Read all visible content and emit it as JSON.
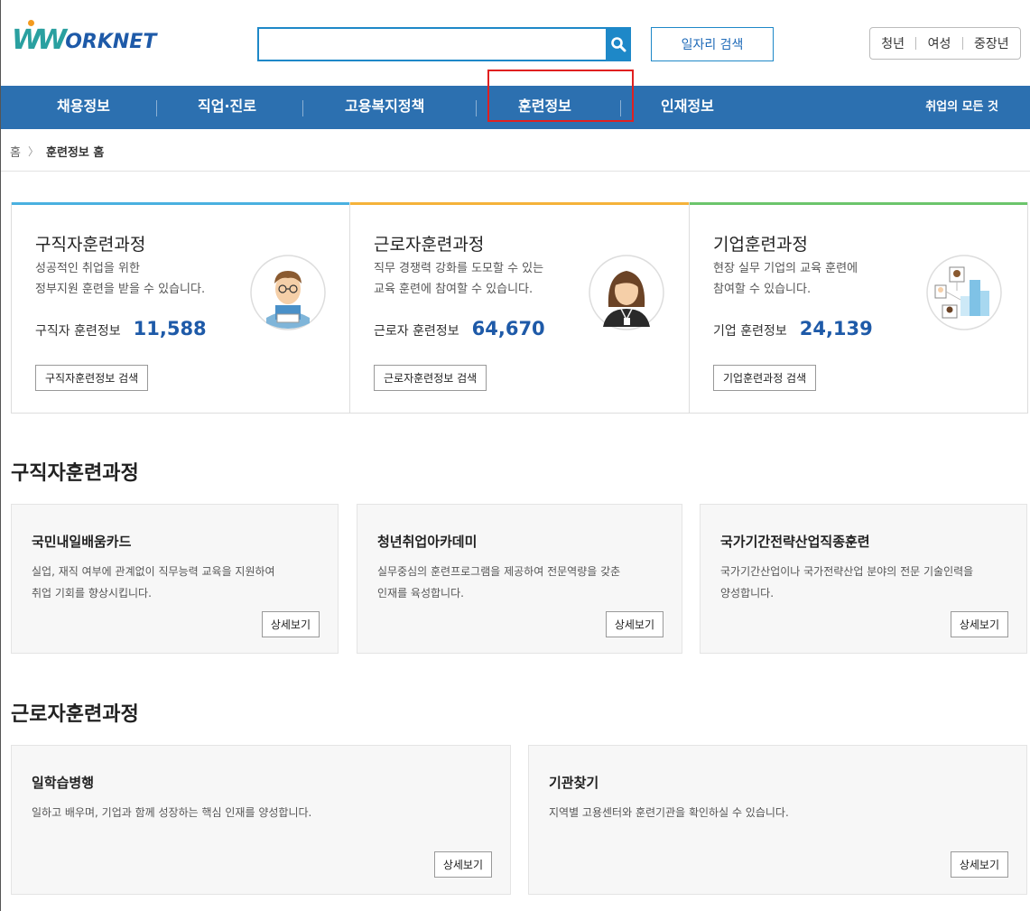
{
  "header": {
    "logo_w": "W",
    "logo_text": "ORKNET",
    "search_value": "",
    "job_search_label": "일자리 검색",
    "quick_links": [
      "청년",
      "여성",
      "중장년"
    ]
  },
  "nav": {
    "items": [
      "채용정보",
      "직업·진로",
      "고용복지정책",
      "훈련정보",
      "인재정보"
    ],
    "all_label": "취업의 모든 것"
  },
  "breadcrumb": {
    "home": "홈",
    "current": "훈련정보 홈"
  },
  "cards": [
    {
      "title": "구직자훈련과정",
      "desc_line1": "성공적인 취업을 위한",
      "desc_line2": "정부지원 훈련을 받을 수 있습니다.",
      "stat_label": "구직자 훈련정보",
      "stat_value": "11,588",
      "button": "구직자훈련정보 검색",
      "accent": "#4ab0e0"
    },
    {
      "title": "근로자훈련과정",
      "desc_line1": "직무 경쟁력 강화를 도모할 수 있는",
      "desc_line2": "교육 훈련에 참여할 수 있습니다.",
      "stat_label": "근로자 훈련정보",
      "stat_value": "64,670",
      "button": "근로자훈련정보 검색",
      "accent": "#f5b23a"
    },
    {
      "title": "기업훈련과정",
      "desc_line1": "현장 실무 기업의 교육 훈련에",
      "desc_line2": "참여할 수 있습니다.",
      "stat_label": "기업 훈련정보",
      "stat_value": "24,139",
      "button": "기업훈련과정 검색",
      "accent": "#6cc56c"
    }
  ],
  "section1": {
    "title": "구직자훈련과정",
    "items": [
      {
        "title": "국민내일배움카드",
        "desc_line1": "실업, 재직 여부에 관계없이 직무능력 교육을 지원하여",
        "desc_line2": "취업 기회를 향상시킵니다.",
        "button": "상세보기"
      },
      {
        "title": "청년취업아카데미",
        "desc_line1": "실무중심의 훈련프로그램을 제공하여 전문역량을 갖춘",
        "desc_line2": "인재를 육성합니다.",
        "button": "상세보기"
      },
      {
        "title": "국가기간전략산업직종훈련",
        "desc_line1": "국가기간산업이나 국가전략산업 분야의 전문 기술인력을",
        "desc_line2": "양성합니다.",
        "button": "상세보기"
      }
    ]
  },
  "section2": {
    "title": "근로자훈련과정",
    "items": [
      {
        "title": "일학습병행",
        "desc_line1": "일하고 배우며, 기업과 함께 성장하는 핵심 인재를 양성합니다.",
        "button": "상세보기"
      },
      {
        "title": "기관찾기",
        "desc_line1": "지역별 고용센터와 훈련기관을 확인하실 수 있습니다.",
        "button": "상세보기"
      }
    ]
  }
}
